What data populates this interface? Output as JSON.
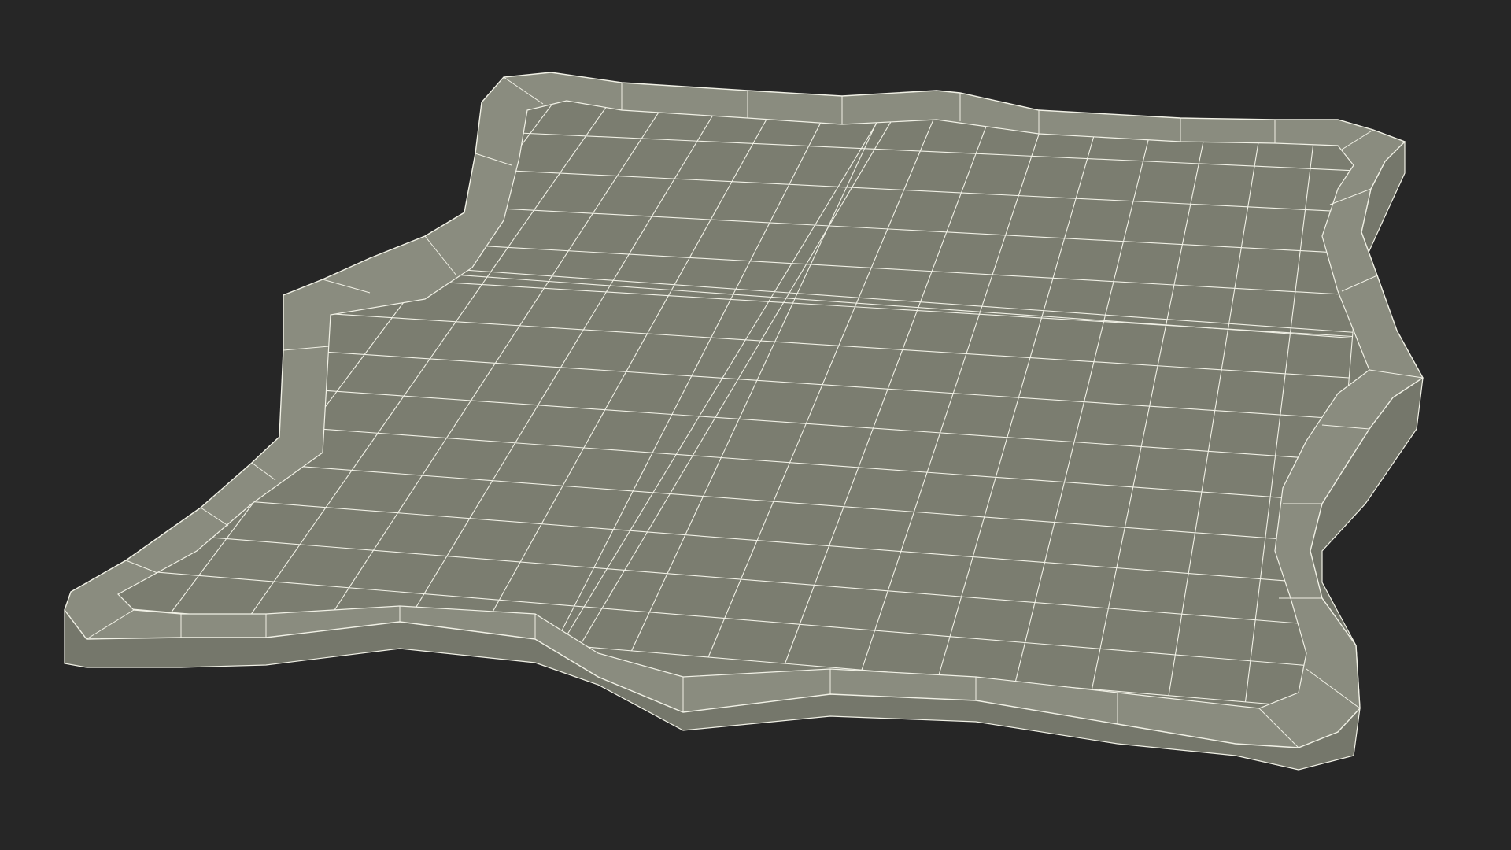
{
  "scene": {
    "subject": "wireframe-mesh",
    "colors": {
      "background": "#262626",
      "surface": "#7b7d70",
      "surface_dark": "#6d6f63",
      "rim": "#8a8c7f",
      "side": "#75776b",
      "wire": "#f1f1e6"
    },
    "grid": {
      "columns": 16,
      "rows": 14
    }
  }
}
